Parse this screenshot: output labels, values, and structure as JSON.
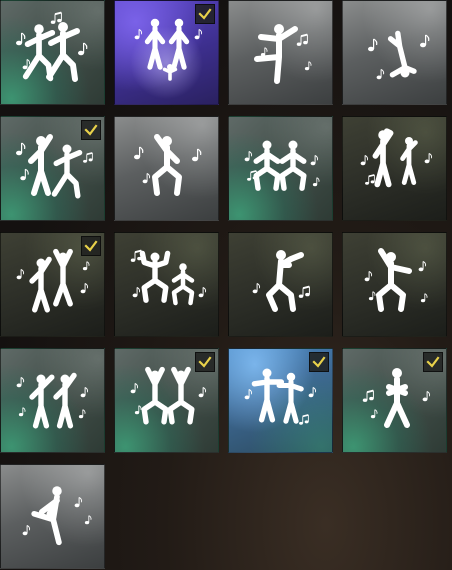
{
  "colors": {
    "check": "#e8d14a",
    "figure": "#ffffff"
  },
  "emotes": [
    {
      "icon": "two-dancers-icon",
      "background": "green",
      "selected": false
    },
    {
      "icon": "two-performers-stage-icon",
      "background": "purple",
      "selected": true
    },
    {
      "icon": "arabesque-pose-icon",
      "background": "grey",
      "selected": false
    },
    {
      "icon": "breakdance-freeze-icon",
      "background": "grey",
      "selected": false
    },
    {
      "icon": "duo-point-dance-icon",
      "background": "green",
      "selected": true
    },
    {
      "icon": "single-point-dance-icon",
      "background": "grey",
      "selected": false
    },
    {
      "icon": "duo-squat-dance-icon",
      "background": "green",
      "selected": false
    },
    {
      "icon": "duo-salute-dance-icon",
      "background": "dark",
      "selected": false
    },
    {
      "icon": "duo-raise-hand-icon",
      "background": "dark",
      "selected": true
    },
    {
      "icon": "duo-flex-squat-icon",
      "background": "dark",
      "selected": false
    },
    {
      "icon": "flute-player-icon",
      "background": "dark",
      "selected": false
    },
    {
      "icon": "disco-point-icon",
      "background": "dark",
      "selected": false
    },
    {
      "icon": "duo-disco-point-icon",
      "background": "green",
      "selected": false
    },
    {
      "icon": "duo-raise-roof-icon",
      "background": "green",
      "selected": true
    },
    {
      "icon": "duo-shoulder-dance-icon",
      "background": "blue",
      "selected": true
    },
    {
      "icon": "arms-crossed-icon",
      "background": "green",
      "selected": true
    },
    {
      "icon": "leg-stretch-icon",
      "background": "grey",
      "selected": false
    }
  ]
}
